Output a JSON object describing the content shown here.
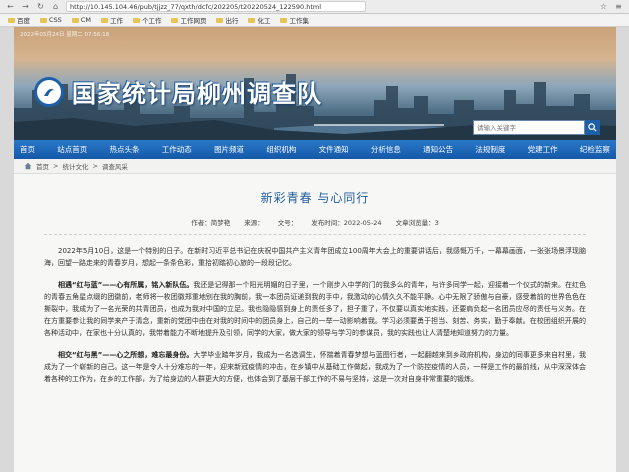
{
  "browser": {
    "url": "http://10.145.104.46/pub/tjjzz_77/qxth/dcfc/202205/t20220524_122590.html"
  },
  "bookmarks": [
    "百度",
    "",
    "CSS",
    "CM",
    "工作",
    "个工作",
    "工作网页",
    "",
    "出行",
    "化工",
    "工作集"
  ],
  "site": {
    "title": "国家统计局柳州调查队",
    "banner_date": "2022年05月24日 星期二 07:56:18",
    "search_placeholder": "请输入关键字"
  },
  "nav": [
    "首页",
    "站点首页",
    "热点头条",
    "工作动态",
    "图片频道",
    "组织机构",
    "文件通知",
    "分析信息",
    "通知公告",
    "法规制度",
    "党建工作",
    "纪检监察"
  ],
  "breadcrumb": {
    "home": "首页",
    "level2": "统计文化",
    "level3": "调查风采"
  },
  "article": {
    "title": "新彩青春 与心同行",
    "meta": {
      "author_label": "作者：",
      "author": "简梦艳",
      "source_label": "来源：",
      "source": "",
      "doc_label": "文号：",
      "doc": "",
      "date_label": "发布时间：",
      "date": "2022-05-24",
      "views_label": "文章浏览量：",
      "views": "3"
    },
    "para1": "2022年5月10日，这是一个特别的日子。在新时习近平总书记在庆祝中国共产主义青年团成立100周年大会上的重要讲话后，我感慨万千，一幕幕画面，一张张场景浮现脑海，回望一路走来的青春岁月，想起一条条色彩，重拾初踏初心旅的一段段记忆。",
    "p2_head": "相遇“红与蓝”——心有所属，铭入新队伍。",
    "para2": "我还是记得那一个阳光明媚的日子里，一个刚步入中学的门的我多么的青年，与许多同学一起，迎接着一个仪式的新来。在红色的青春五角星点缀的团徽前，老师将一枚团徽郑重地别在我的胸前，我一本团员证递到我的手中，我激动的心情久久不能平静。心中无限了骄傲与自豪，感受着前的世界色色在撕裂中，我成为了一名光荣的共青团员，也成为我对中国的立足。我也隐隐感到身上的责任多了，担子重了，不仅要以真实地实践，还要肩负起一名团员应尽的责任与义务。在在方重要参让我的同学来产于清念，重新的党团中由在对我的时间中的团员身上，自己的一举一动影响着我。学习必须要勇于担当、刻苦、务实，勤于奉献。在校团组织开展的各种活动中，在家也十分认真的，我带着能力不断地提升及引领，同学的大家，做大家的领导与学习的参谋员，我的实践也让人清楚地知道努力的力量。",
    "p3_head": "相交“红与黑”——心之所想，难忘最身份。",
    "para3": "大学毕业踏年岁月，我成为一名选调生，怀揣着青春梦想与蓝图行者，一起翻越来到乡政府机构，身边的同事更多来自村里，我成为了一个崭新的自己。这一年是令人十分难忘的一年，迎来新冠疫情的冲击，在乡镇中从基础工作做起，我成为了一个防控疫情的人员，一样是工作的最前线，从中深深体会着各种的工作为，在乡的工作部，为了给身边的人群更大的方便，也体会到了基层干部工作的不易与坚持，这是一次对自身非常重要的锻炼。"
  }
}
